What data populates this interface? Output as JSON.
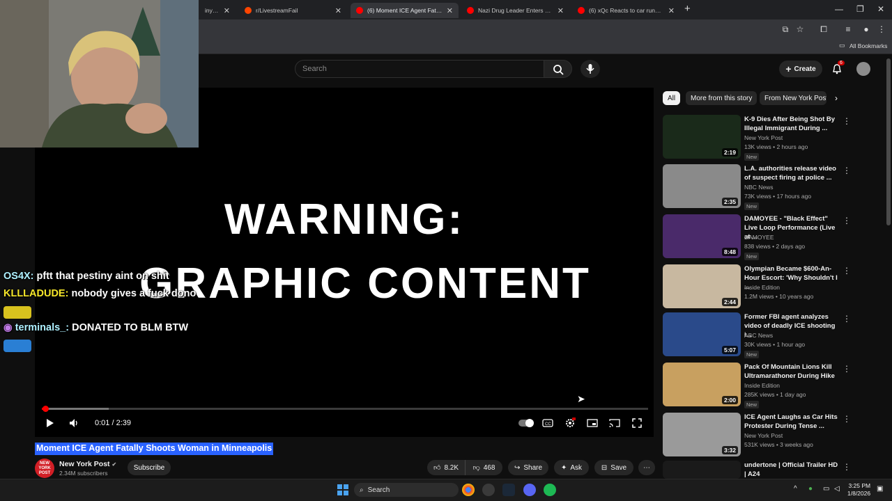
{
  "browser": {
    "tabs": [
      {
        "title": "iny into !",
        "favicon_color": "#cc0000"
      },
      {
        "title": "r/LivestreamFail",
        "favicon_color": "#ff4500"
      },
      {
        "title": "(6) Moment ICE Agent Fatally S",
        "favicon_color": "#ff0000"
      },
      {
        "title": "Nazi Drug Leader Enters Gunfig",
        "favicon_color": "#ff0000"
      },
      {
        "title": "(6) xQc Reacts to car running o",
        "favicon_color": "#ff0000"
      }
    ],
    "new_tab_glyph": "+",
    "bookmarks_label": "All Bookmarks"
  },
  "youtube": {
    "search_placeholder": "Search",
    "create_label": "Create",
    "notification_count": "6"
  },
  "video": {
    "overlay_line1": "WARNING:",
    "overlay_line2": "GRAPHIC CONTENT",
    "time": "0:01 / 2:39",
    "played_fraction": 0.006,
    "buffered_fraction": 0.11,
    "title": "Moment ICE Agent Fatally Shoots Woman in Minneapolis",
    "channel": "New York Post",
    "channel_avatar_text": "NEW YORK POST",
    "subscribers": "2.34M subscribers",
    "subscribe_label": "Subscribe",
    "likes": "8.2K",
    "dislikes": "468",
    "share_label": "Share",
    "ask_label": "Ask",
    "save_label": "Save"
  },
  "chat": [
    {
      "user": "OS4X:",
      "message": "pftt that pestiny aint on shit"
    },
    {
      "user": "KLLLADUDE:",
      "message": "nobody gives a fuck dono"
    },
    {
      "user": "terminals_:",
      "message": "DONATED TO BLM BTW"
    }
  ],
  "sidebar": {
    "chips": [
      "All",
      "More from this story",
      "From New York Post"
    ],
    "recommendations": [
      {
        "title": "K-9 Dies After Being Shot By Illegal Immigrant During ...",
        "channel": "New York Post",
        "meta": "13K views • 2 hours ago",
        "badge": "New",
        "duration": "2:19",
        "thumb": "#1a2a1a"
      },
      {
        "title": "L.A. authorities release video of suspect firing at police ...",
        "channel": "NBC News",
        "meta": "73K views • 17 hours ago",
        "badge": "New",
        "duration": "2:35",
        "thumb": "#8a8a8a"
      },
      {
        "title": "DAMOYEE - \"Black Effect\" Live Loop Performance (Live at ...",
        "channel": "DAMOYEE",
        "meta": "838 views • 2 days ago",
        "badge": "New",
        "duration": "8:48",
        "thumb": "#4a2a6a"
      },
      {
        "title": "Olympian Became $600-An-Hour Escort: 'Why Shouldn't I ...",
        "channel": "Inside Edition",
        "meta": "1.2M views • 10 years ago",
        "badge": "",
        "duration": "2:44",
        "thumb": "#c8b8a0"
      },
      {
        "title": "Former FBI agent analyzes video of deadly ICE shooting i...",
        "channel": "ABC News",
        "meta": "30K views • 1 hour ago",
        "badge": "New",
        "duration": "5:07",
        "thumb": "#2a4a8a"
      },
      {
        "title": "Pack Of Mountain Lions Kill Ultramarathoner During Hike",
        "channel": "Inside Edition",
        "meta": "285K views • 1 day ago",
        "badge": "New",
        "duration": "2:00",
        "thumb": "#c8a060"
      },
      {
        "title": "ICE Agent Laughs as Car Hits Protester During Tense ...",
        "channel": "New York Post",
        "meta": "531K views • 3 weeks ago",
        "badge": "",
        "duration": "3:32",
        "thumb": "#9a9a9a"
      },
      {
        "title": "undertone | Official Trailer HD | A24",
        "channel": "",
        "meta": "",
        "badge": "",
        "duration": "",
        "thumb": "#1a1a1a"
      }
    ]
  },
  "taskbar": {
    "search_label": "Search",
    "time": "3:25 PM",
    "date": "1/8/2026"
  }
}
